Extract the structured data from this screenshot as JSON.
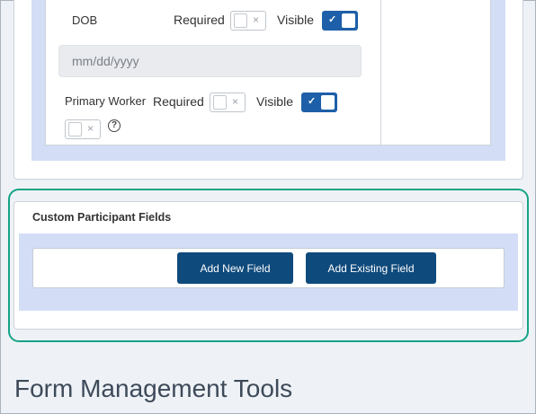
{
  "participant_fields": {
    "dob": {
      "label": "DOB",
      "required_label": "Required",
      "visible_label": "Visible",
      "required": false,
      "visible": true,
      "input_placeholder": "mm/dd/yyyy"
    },
    "primary_worker": {
      "label": "Primary Worker",
      "required_label": "Required",
      "visible_label": "Visible",
      "required": false,
      "visible": true,
      "extra_toggle": false,
      "help_icon": "question-circle-icon",
      "help_glyph": "?"
    },
    "toggle_glyphs": {
      "off": "×",
      "on": "✓"
    }
  },
  "custom_fields": {
    "title": "Custom Participant Fields",
    "add_new_label": "Add New Field",
    "add_existing_label": "Add Existing Field"
  },
  "section": {
    "title": "Form Management Tools"
  },
  "colors": {
    "accent": "#1d5fa8",
    "button": "#0f4a7c",
    "highlight": "#15a385",
    "band": "#d3def6"
  }
}
